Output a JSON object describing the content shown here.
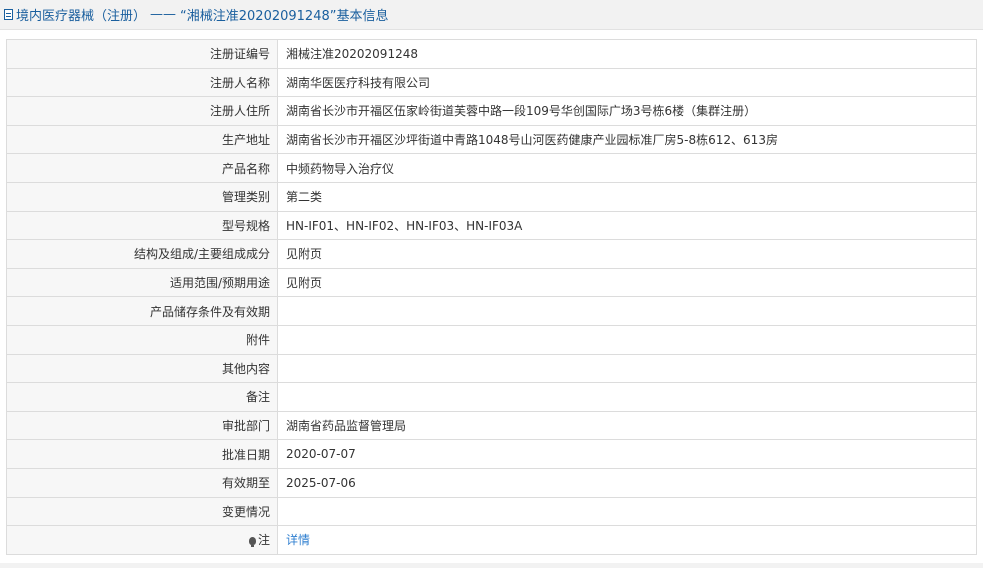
{
  "header": {
    "category": "境内医疗器械（注册）",
    "separator": "——",
    "registration_quoted": "“湘械注准20202091248”",
    "suffix": "基本信息"
  },
  "rows": [
    {
      "label": "注册证编号",
      "value": "湘械注准20202091248"
    },
    {
      "label": "注册人名称",
      "value": "湖南华医医疗科技有限公司"
    },
    {
      "label": "注册人住所",
      "value": "湖南省长沙市开福区伍家岭街道芙蓉中路一段109号华创国际广场3号栋6楼（集群注册）"
    },
    {
      "label": "生产地址",
      "value": "湖南省长沙市开福区沙坪街道中青路1048号山河医药健康产业园标准厂房5-8栋612、613房"
    },
    {
      "label": "产品名称",
      "value": "中频药物导入治疗仪"
    },
    {
      "label": "管理类别",
      "value": "第二类"
    },
    {
      "label": "型号规格",
      "value": "HN-IF01、HN-IF02、HN-IF03、HN-IF03A"
    },
    {
      "label": "结构及组成/主要组成成分",
      "value": "见附页"
    },
    {
      "label": "适用范围/预期用途",
      "value": "见附页"
    },
    {
      "label": "产品储存条件及有效期",
      "value": ""
    },
    {
      "label": "附件",
      "value": ""
    },
    {
      "label": "其他内容",
      "value": ""
    },
    {
      "label": "备注",
      "value": ""
    },
    {
      "label": "审批部门",
      "value": "湖南省药品监督管理局"
    },
    {
      "label": "批准日期",
      "value": "2020-07-07"
    },
    {
      "label": "有效期至",
      "value": "2025-07-06"
    },
    {
      "label": "变更情况",
      "value": ""
    }
  ],
  "note_row": {
    "icon": "lightbulb-icon",
    "label": "注",
    "link_text": "详情"
  },
  "colors": {
    "header_text": "#1a5f9e",
    "link": "#2f7fd0",
    "label_bg": "#f7f7f7",
    "border": "#dcdcdc"
  }
}
